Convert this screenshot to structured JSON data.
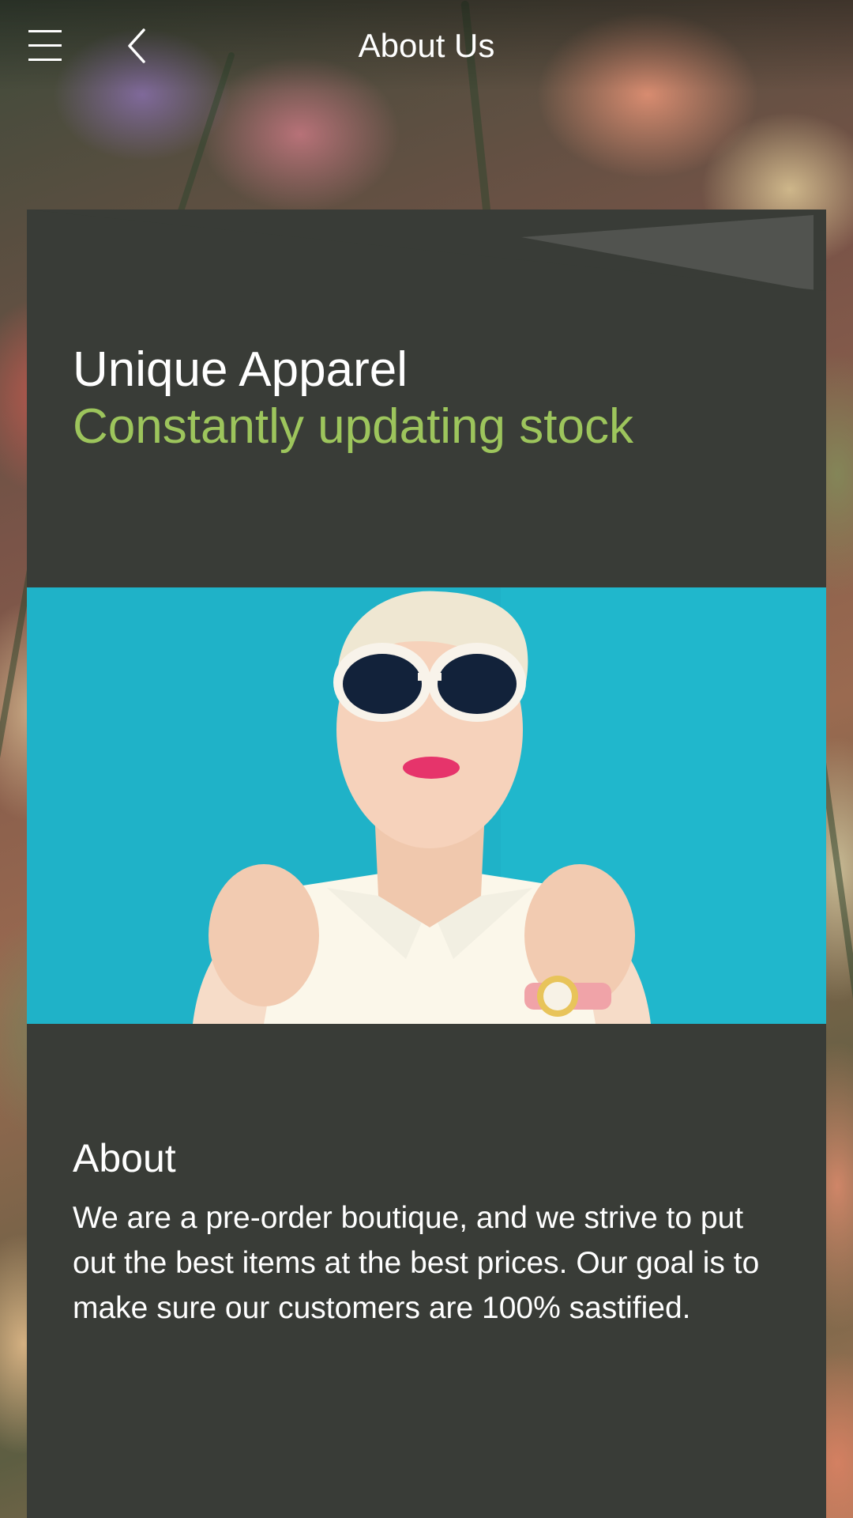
{
  "header": {
    "title": "About Us",
    "menu_icon": "hamburger-menu-icon",
    "back_icon": "chevron-left-icon"
  },
  "hero_section": {
    "headline": "Unique Apparel",
    "subheadline": "Constantly updating stock"
  },
  "about": {
    "heading": "About",
    "body": "We are a pre-order boutique, and we strive to put out the best items at the best prices. Our goal is to make sure our customers are 100% sastified."
  },
  "colors": {
    "card_background": "#393c37",
    "accent_green": "#9dc55c",
    "text_white": "#ffffff",
    "image_backdrop": "#1fb2c8"
  }
}
